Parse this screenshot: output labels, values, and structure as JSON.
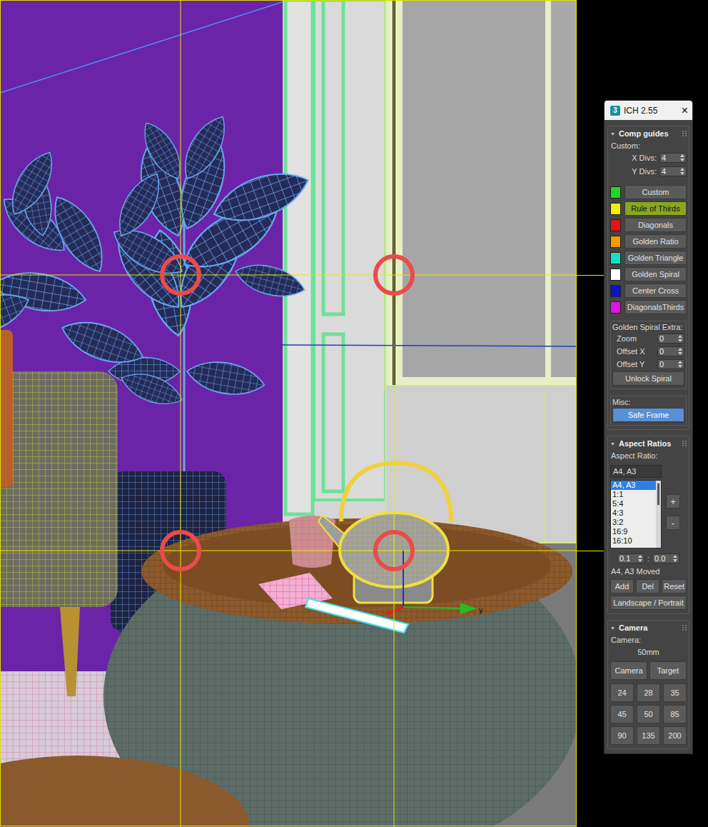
{
  "viewport": {
    "gizmo_axis_label": "y"
  },
  "window": {
    "app_icon": "3",
    "title": "ICH 2.55",
    "close": "×"
  },
  "comp_guides": {
    "toggle": "▼",
    "title": "Comp guides",
    "custom_label": "Custom:",
    "spinners": [
      {
        "label": "X Divs:",
        "value": "4"
      },
      {
        "label": "Y Divs:",
        "value": "4"
      }
    ],
    "guides": [
      {
        "label": "Custom",
        "color": "#22d622",
        "selected": false
      },
      {
        "label": "Rule of Thirds",
        "color": "#eef000",
        "selected": true
      },
      {
        "label": "Diagonals",
        "color": "#e01414",
        "selected": false
      },
      {
        "label": "Golden Ratio",
        "color": "#f59a00",
        "selected": false
      },
      {
        "label": "Golden Triangle",
        "color": "#14e0c4",
        "selected": false
      },
      {
        "label": "Golden Spiral",
        "color": "#ffffff",
        "selected": false
      },
      {
        "label": "Center Cross",
        "color": "#0a14c0",
        "selected": false
      },
      {
        "label": "DiagonalsThirds",
        "color": "#e014e0",
        "selected": false
      }
    ],
    "spiral_extra": {
      "label": "Golden Spiral Extra:",
      "spinners": [
        {
          "label": "Zoom",
          "value": "0"
        },
        {
          "label": "Offset X",
          "value": "0"
        },
        {
          "label": "Offset Y",
          "value": "0"
        }
      ],
      "button": "Unlock Spiral"
    },
    "misc": {
      "label": "Misc:",
      "safe_frame": {
        "label": "Safe Frame",
        "on": true
      }
    }
  },
  "aspect_ratios": {
    "toggle": "▼",
    "title": "Aspect Ratios",
    "label": "Aspect Ratio:",
    "field": "A4, A3",
    "list": [
      {
        "label": "A4, A3",
        "selected": true
      },
      {
        "label": "1:1",
        "selected": false
      },
      {
        "label": "5:4",
        "selected": false
      },
      {
        "label": "4:3",
        "selected": false
      },
      {
        "label": "3:2",
        "selected": false
      },
      {
        "label": "16:9",
        "selected": false
      },
      {
        "label": "16:10",
        "selected": false
      }
    ],
    "add_icon": "+",
    "remove_icon": "-",
    "spinners": [
      {
        "value": "0.1"
      },
      {
        "value": "0.0"
      }
    ],
    "separator": ":",
    "status": "A4, A3 Moved",
    "buttons": [
      "Add",
      "Del",
      "Reset"
    ],
    "orientation_button": "Landscape / Portrait"
  },
  "camera": {
    "toggle": "▼",
    "title": "Camera",
    "label": "Camera:",
    "focal": "50mm",
    "buttons": [
      "Camera",
      "Target"
    ],
    "lenses": [
      "24",
      "28",
      "35",
      "45",
      "50",
      "85",
      "90",
      "135",
      "200"
    ]
  }
}
